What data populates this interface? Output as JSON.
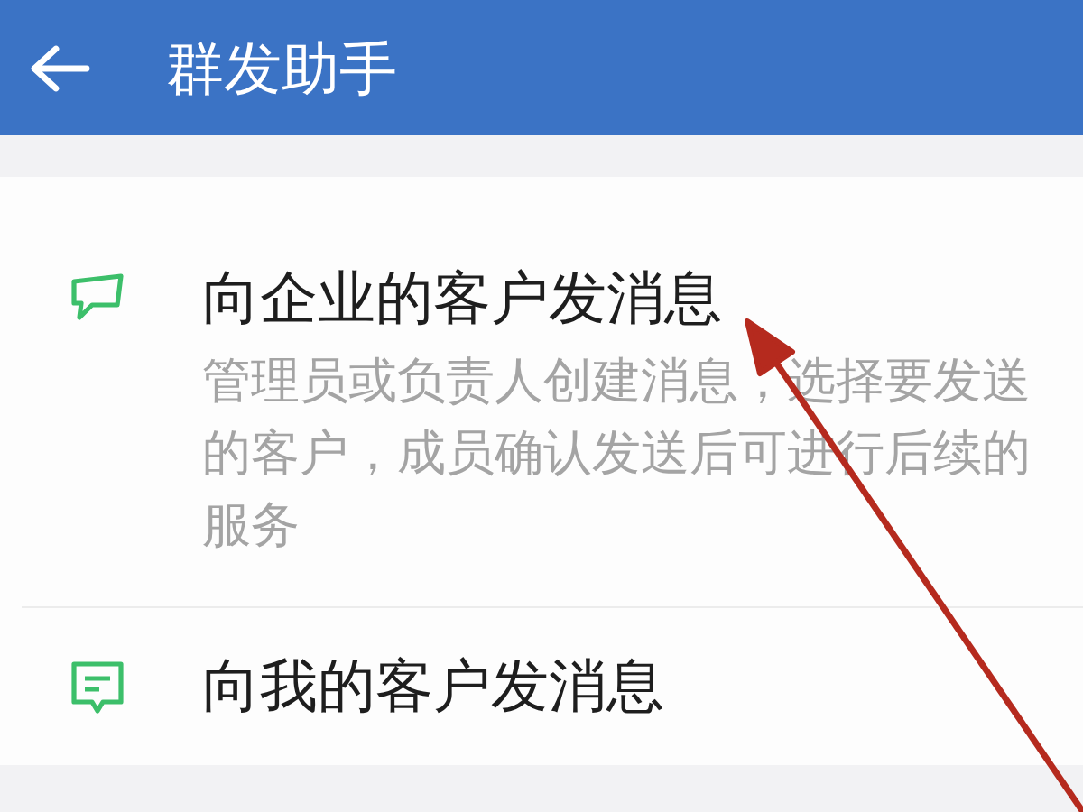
{
  "header": {
    "title": "群发助手"
  },
  "items": [
    {
      "kind": "broadcast",
      "title": "向企业的客户发消息",
      "description": "管理员或负责人创建消息，选择要发送的客户，成员确认发送后可进行后续的服务"
    },
    {
      "kind": "chat",
      "title": "向我的客户发消息"
    }
  ]
}
